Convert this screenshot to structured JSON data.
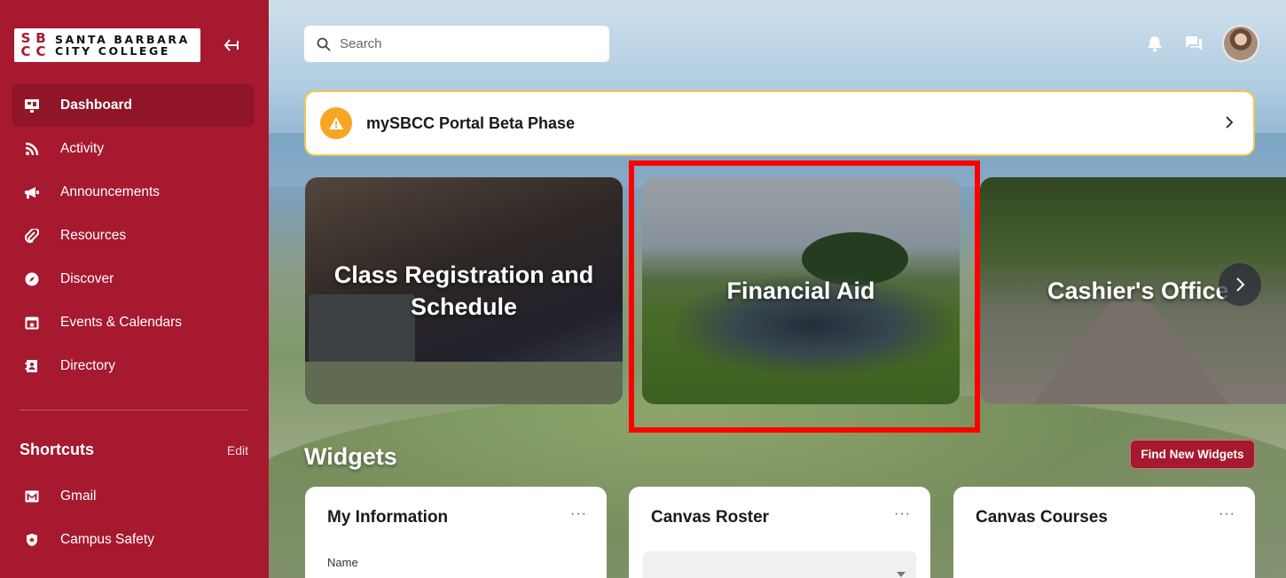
{
  "logo": {
    "mark": [
      "S",
      "B",
      "C",
      "C"
    ],
    "line1": "SANTA BARBARA",
    "line2": "CITY COLLEGE"
  },
  "sidebar": {
    "items": [
      {
        "label": "Dashboard",
        "icon": "dashboard-icon",
        "active": true
      },
      {
        "label": "Activity",
        "icon": "rss-icon"
      },
      {
        "label": "Announcements",
        "icon": "megaphone-icon"
      },
      {
        "label": "Resources",
        "icon": "paperclip-icon"
      },
      {
        "label": "Discover",
        "icon": "compass-icon"
      },
      {
        "label": "Events & Calendars",
        "icon": "calendar-icon"
      },
      {
        "label": "Directory",
        "icon": "address-book-icon"
      }
    ],
    "shortcuts_title": "Shortcuts",
    "shortcuts_edit": "Edit",
    "shortcuts": [
      {
        "label": "Gmail",
        "icon": "mail-icon"
      },
      {
        "label": "Campus Safety",
        "icon": "badge-icon"
      }
    ]
  },
  "search": {
    "placeholder": "Search"
  },
  "banner": {
    "text": "mySBCC Portal Beta Phase"
  },
  "cards": [
    {
      "title": "Class Registration and Schedule"
    },
    {
      "title": "Financial Aid"
    },
    {
      "title": "Cashier's Office"
    }
  ],
  "widgets": {
    "title": "Widgets",
    "find_button": "Find New Widgets",
    "items": [
      {
        "title": "My Information",
        "more": "···",
        "name_label": "Name"
      },
      {
        "title": "Canvas Roster",
        "more": "···"
      },
      {
        "title": "Canvas Courses",
        "more": "···"
      }
    ]
  },
  "colors": {
    "brand": "#a6192e",
    "brand_dark": "#8f1527",
    "warning": "#f6a623",
    "highlight": "#ff0000"
  }
}
